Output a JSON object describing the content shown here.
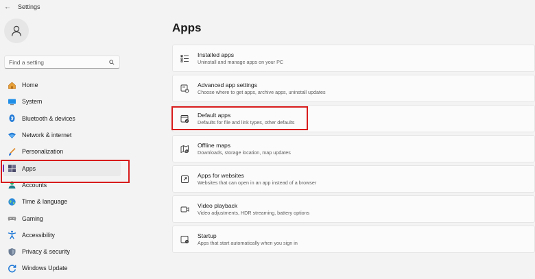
{
  "window": {
    "title": "Settings"
  },
  "sidebar": {
    "search": {
      "placeholder": "Find a setting"
    },
    "items": [
      {
        "label": "Home",
        "icon": "home-icon"
      },
      {
        "label": "System",
        "icon": "system-icon"
      },
      {
        "label": "Bluetooth & devices",
        "icon": "bluetooth-icon"
      },
      {
        "label": "Network & internet",
        "icon": "wifi-icon"
      },
      {
        "label": "Personalization",
        "icon": "brush-icon"
      },
      {
        "label": "Apps",
        "icon": "apps-icon",
        "selected": true
      },
      {
        "label": "Accounts",
        "icon": "account-icon"
      },
      {
        "label": "Time & language",
        "icon": "globe-icon"
      },
      {
        "label": "Gaming",
        "icon": "gamepad-icon"
      },
      {
        "label": "Accessibility",
        "icon": "accessibility-icon"
      },
      {
        "label": "Privacy & security",
        "icon": "shield-icon"
      },
      {
        "label": "Windows Update",
        "icon": "update-icon"
      }
    ]
  },
  "main": {
    "title": "Apps",
    "cards": [
      {
        "title": "Installed apps",
        "desc": "Uninstall and manage apps on your PC",
        "icon": "list-icon"
      },
      {
        "title": "Advanced app settings",
        "desc": "Choose where to get apps, archive apps, uninstall updates",
        "icon": "settings-app-icon"
      },
      {
        "title": "Default apps",
        "desc": "Defaults for file and link types, other defaults",
        "icon": "default-apps-icon"
      },
      {
        "title": "Offline maps",
        "desc": "Downloads, storage location, map updates",
        "icon": "map-icon"
      },
      {
        "title": "Apps for websites",
        "desc": "Websites that can open in an app instead of a browser",
        "icon": "open-link-icon"
      },
      {
        "title": "Video playback",
        "desc": "Video adjustments, HDR streaming, battery options",
        "icon": "video-icon"
      },
      {
        "title": "Startup",
        "desc": "Apps that start automatically when you sign in",
        "icon": "startup-icon"
      }
    ]
  },
  "colors": {
    "accent": "#6f2fb0",
    "highlight": "#d81b1b",
    "background": "#f3f3f3",
    "card": "#fbfbfb"
  }
}
